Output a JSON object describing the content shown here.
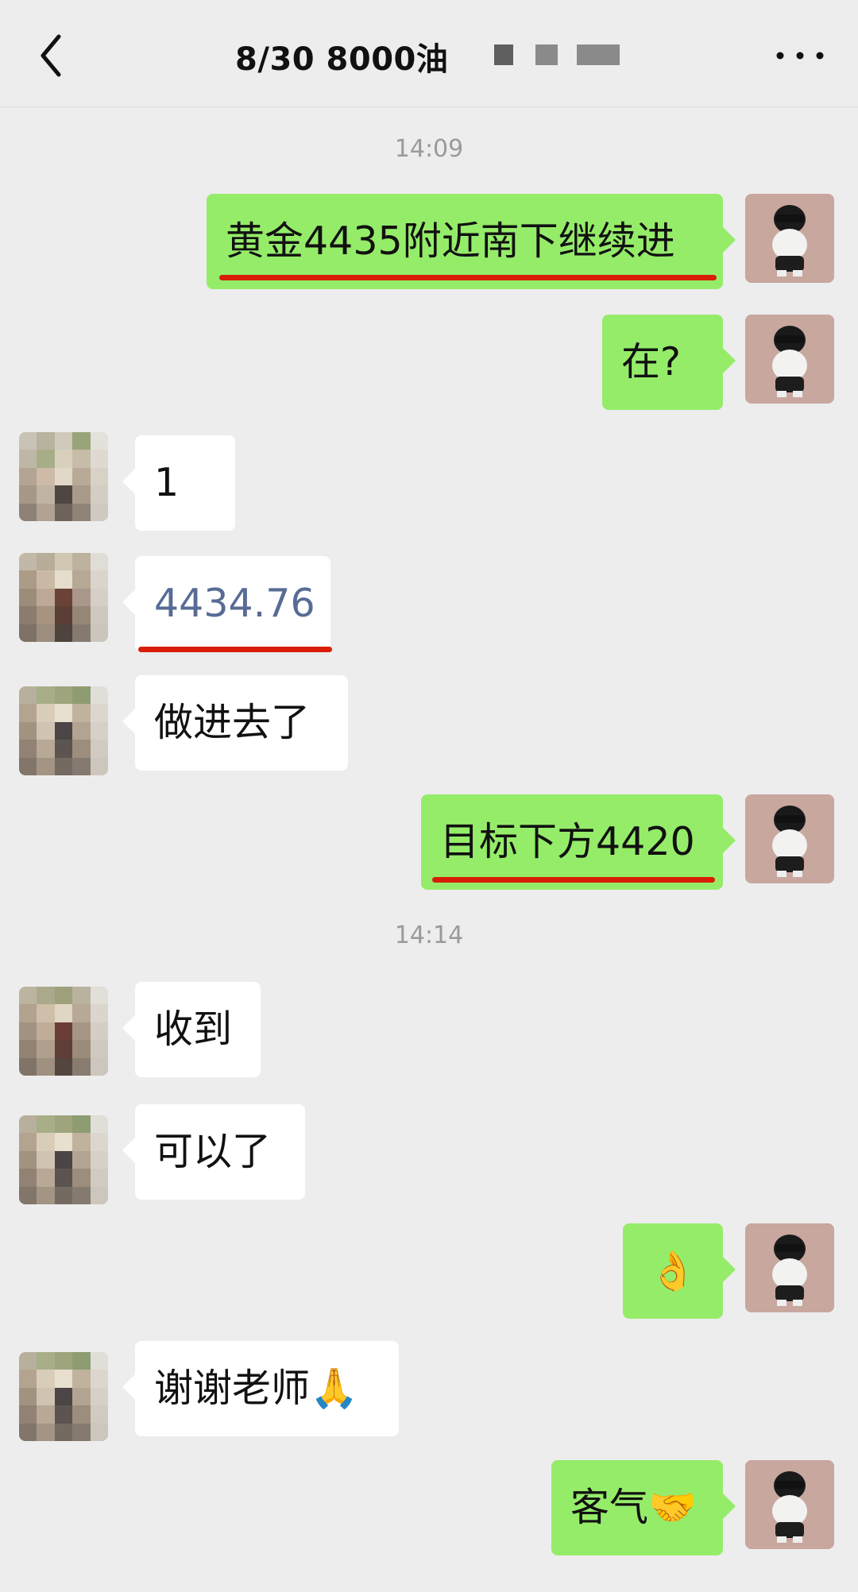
{
  "header": {
    "title": "8/30  8000油",
    "back_icon": "chevron-left-icon",
    "more_icon": "more-dots-icon"
  },
  "timestamps": [
    "14:09",
    "14:14"
  ],
  "messages": [
    {
      "from": "me",
      "text": "黄金4435附近南下继续进",
      "underlined": true
    },
    {
      "from": "me",
      "text": "在?"
    },
    {
      "from": "other",
      "text": "1"
    },
    {
      "from": "other",
      "text": "4434.76",
      "style": "link",
      "underlined": true
    },
    {
      "from": "other",
      "text": "做进去了"
    },
    {
      "from": "me",
      "text": "目标下方4420",
      "underlined": true
    },
    {
      "from": "other",
      "text": "收到"
    },
    {
      "from": "other",
      "text": "可以了"
    },
    {
      "from": "me",
      "text": "👌"
    },
    {
      "from": "other",
      "text": "谢谢老师🙏"
    },
    {
      "from": "me",
      "text": "客气🤝"
    }
  ],
  "colors": {
    "background": "#ededed",
    "me_bubble": "#95ec69",
    "other_bubble": "#ffffff",
    "link_text": "#576b95",
    "underline": "#d81e06",
    "timestamp": "#9a9a9a"
  }
}
